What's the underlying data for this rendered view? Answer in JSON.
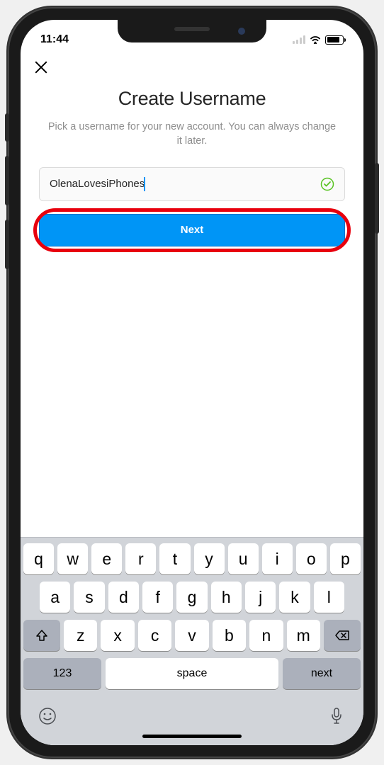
{
  "statusbar": {
    "time": "11:44"
  },
  "header": {
    "title": "Create Username",
    "subtitle": "Pick a username for your new account. You can always change it later."
  },
  "form": {
    "username_value": "OlenaLovesiPhones",
    "next_label": "Next"
  },
  "keyboard": {
    "row1": [
      "q",
      "w",
      "e",
      "r",
      "t",
      "y",
      "u",
      "i",
      "o",
      "p"
    ],
    "row2": [
      "a",
      "s",
      "d",
      "f",
      "g",
      "h",
      "j",
      "k",
      "l"
    ],
    "row3": [
      "z",
      "x",
      "c",
      "v",
      "b",
      "n",
      "m"
    ],
    "numeric_label": "123",
    "space_label": "space",
    "action_label": "next"
  }
}
